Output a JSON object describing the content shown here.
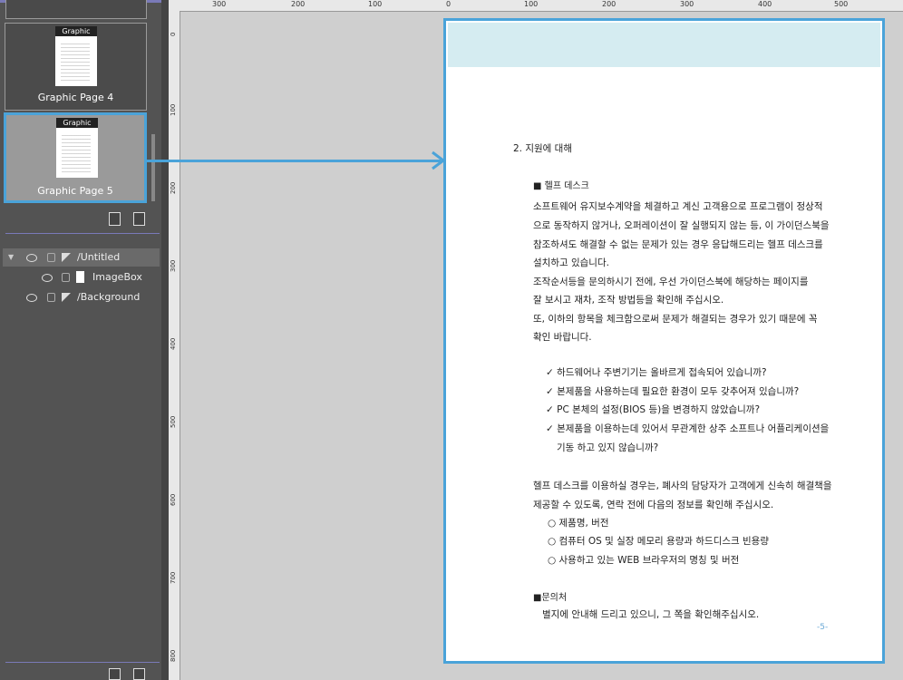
{
  "pages_panel": {
    "thumbnails": [
      {
        "mini_header": "Graphic",
        "caption": "Graphic Page 4"
      },
      {
        "mini_header": "Graphic",
        "caption": "Graphic Page 5"
      }
    ]
  },
  "layers": [
    {
      "name": "/Untitled",
      "selected": true,
      "expanded": true
    },
    {
      "name": "ImageBox",
      "selected": false
    },
    {
      "name": "/Background",
      "selected": false
    }
  ],
  "ruler": {
    "top_ticks": [
      "300",
      "200",
      "100",
      "0",
      "100",
      "200",
      "300",
      "400",
      "500"
    ],
    "left_ticks": [
      "0",
      "100",
      "200",
      "300",
      "400",
      "500",
      "600",
      "700",
      "800"
    ]
  },
  "document": {
    "section_title": "2. 지원에 대해",
    "helpdesk_heading": "■ 헬프 데스크",
    "para1": [
      "소프트웨어 유지보수계약을 체결하고 계신 고객용으로 프로그램이 정상적",
      "으로 동작하지 않거나, 오퍼레이션이 잘 실행되지 않는 등, 이 가이던스북을",
      "참조하셔도 해결할 수 없는 문제가 있는 경우 응답해드리는 헬프 데스크를",
      "설치하고 있습니다.",
      "조작순서등을 문의하시기 전에, 우선 가이던스북에 해당하는 페이지를",
      "잘 보시고 재차, 조작 방법등을 확인해 주십시오.",
      "또, 이하의 항목을 체크함으로써 문제가 해결되는 경우가 있기 때문에 꼭",
      "확인 바랍니다."
    ],
    "checklist": [
      "✓ 하드웨어나 주변기기는 올바르게 접속되어 있습니까?",
      "✓ 본제품을 사용하는데 필요한 환경이 모두 갖추어져 있습니까?",
      "✓ PC 본체의 설정(BIOS 등)을 변경하지 않았습니까?",
      "✓ 본제품을 이용하는데 있어서 무관계한 상주 소프트나 어플리케이션을",
      "기동 하고 있지 않습니까?"
    ],
    "para2": [
      "헬프 데스크를 이용하실 경우는, 폐사의 담당자가 고객에게 신속히 해결책을",
      "제공할 수 있도록, 연락 전에 다음의 정보를 확인해 주십시오."
    ],
    "info_items": [
      "○ 제품명, 버전",
      "○ 컴퓨터 OS 및 실장 메모리 용량과 하드디스크 빈용량",
      "○ 사용하고 있는 WEB 브라우저의 명칭 및 버전"
    ],
    "contact_heading": "■문의처",
    "contact_text": "별지에 안내해 드리고 있으니, 그 쪽을 확인해주십시오.",
    "page_number": "-5-"
  },
  "colors": {
    "highlight": "#4aa3d9",
    "panel_bg": "#535353",
    "page_band": "#d5ecf1"
  }
}
